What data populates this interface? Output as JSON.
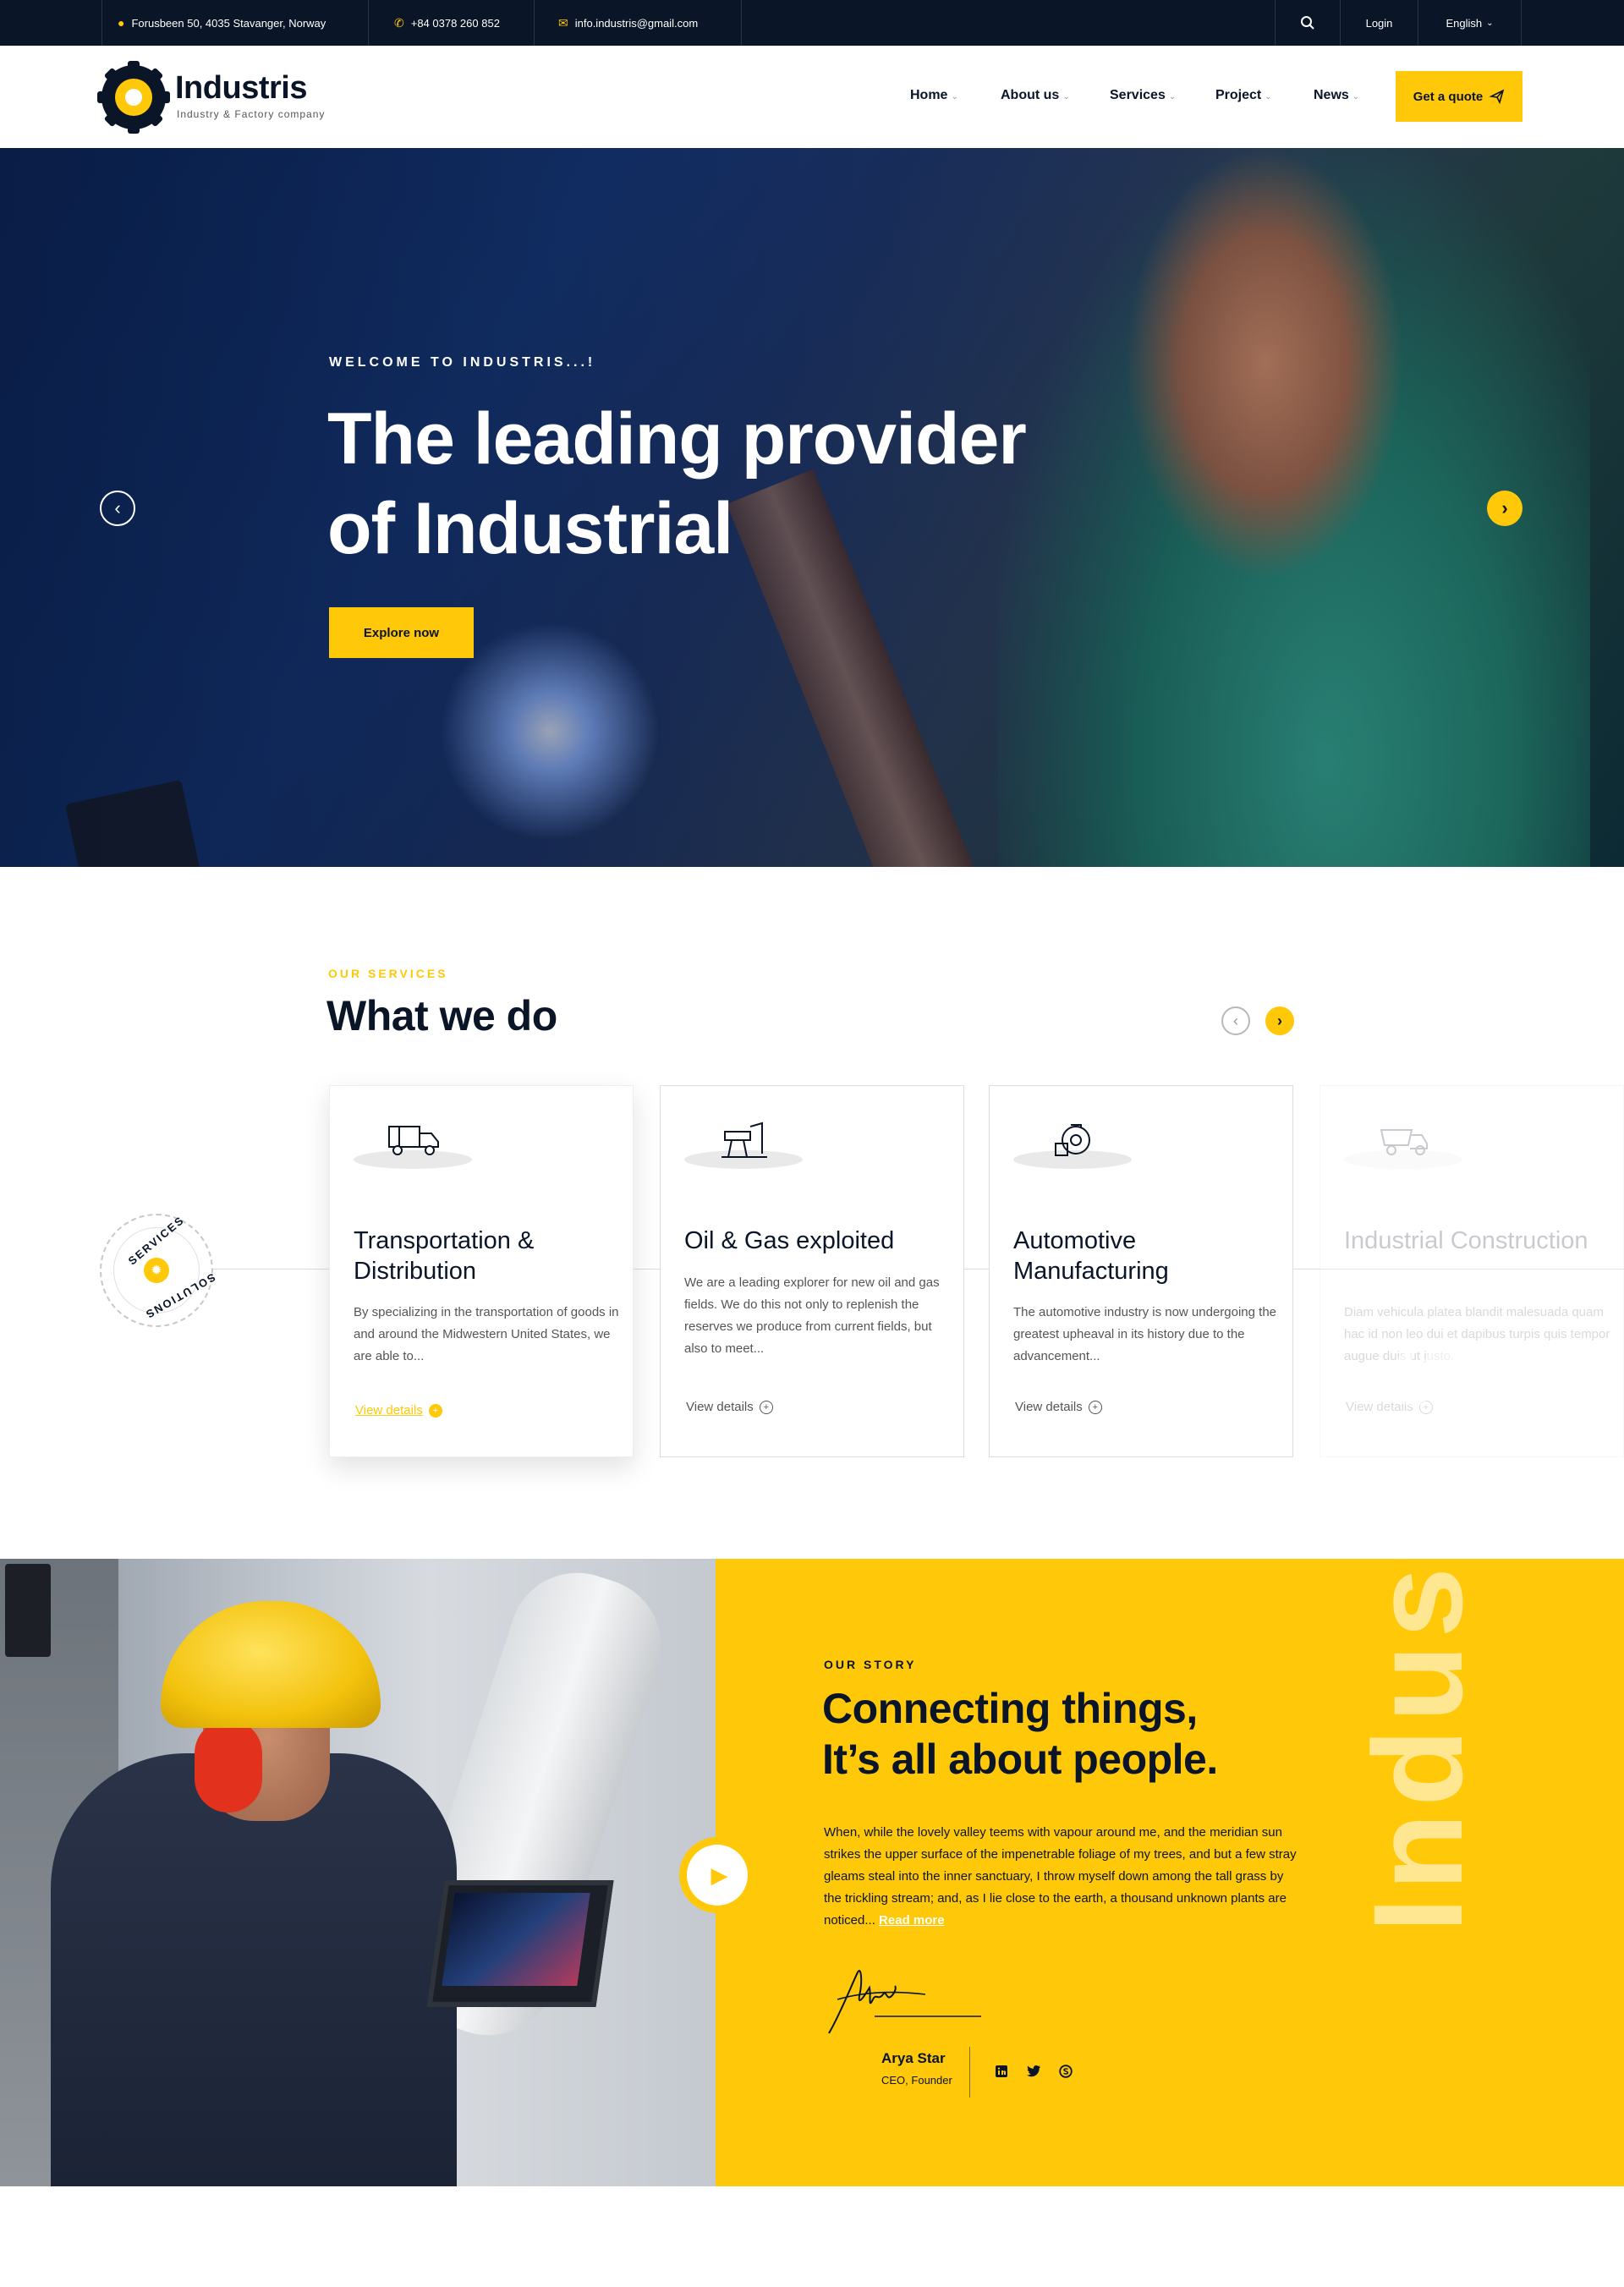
{
  "topbar": {
    "address": "Forusbeen 50, 4035 Stavanger, Norway",
    "phone": "+84 0378 260 852",
    "email": "info.industris@gmail.com",
    "login": "Login",
    "language": "English"
  },
  "brand": {
    "name": "Industris",
    "tagline": "Industry & Factory company"
  },
  "nav": {
    "items": [
      {
        "label": "Home"
      },
      {
        "label": "About us"
      },
      {
        "label": "Services"
      },
      {
        "label": "Project"
      },
      {
        "label": "News"
      }
    ],
    "cta": "Get a quote"
  },
  "hero": {
    "eyebrow": "WELCOME TO INDUSTRIS...!",
    "title_line1": "The leading provider",
    "title_line2": "of Industrial",
    "button": "Explore now"
  },
  "services": {
    "eyebrow": "OUR SERVICES",
    "title": "What we do",
    "badge_top": "SERVICES",
    "badge_bottom": "SOLUTIONS",
    "cards": [
      {
        "title": "Transportation & Distribution",
        "text": "By specializing in the transportation of goods in and around the Midwestern United States, we are able to...",
        "link": "View details",
        "icon": "truck-icon"
      },
      {
        "title": "Oil & Gas exploited",
        "text": "We are a leading explorer for new oil and gas fields. We do this not only to replenish the reserves we produce from current fields, but also to meet...",
        "link": "View details",
        "icon": "oil-pump-icon"
      },
      {
        "title": "Automotive Manufacturing",
        "text": "The automotive industry is now undergoing the greatest upheaval in its history due to the advancement...",
        "link": "View details",
        "icon": "turbine-icon"
      },
      {
        "title": "Industrial Construction",
        "text": "Diam vehicula platea blandit malesuada quam hac id non leo dui et dapibus turpis quis tempor augue duis ut justo.",
        "link": "View details",
        "icon": "dump-truck-icon"
      }
    ]
  },
  "story": {
    "eyebrow": "OUR STORY",
    "title_line1": "Connecting things,",
    "title_line2": "It’s all about people.",
    "text": "When, while the lovely valley teems with vapour around me, and the meridian sun strikes the upper surface of the impenetrable foliage of my trees, and but a few stray gleams steal into the inner sanctuary, I throw myself down among the tall grass by the trickling stream; and, as I lie close to the earth, a thousand unknown plants are noticed...",
    "read_more": "Read more",
    "big_word": "Industris",
    "author_name": "Arya Star",
    "author_role": "CEO, Founder",
    "social": [
      "linkedin-icon",
      "twitter-icon",
      "skype-icon"
    ]
  },
  "colors": {
    "accent": "#ffc809",
    "navy": "#0b1528"
  }
}
